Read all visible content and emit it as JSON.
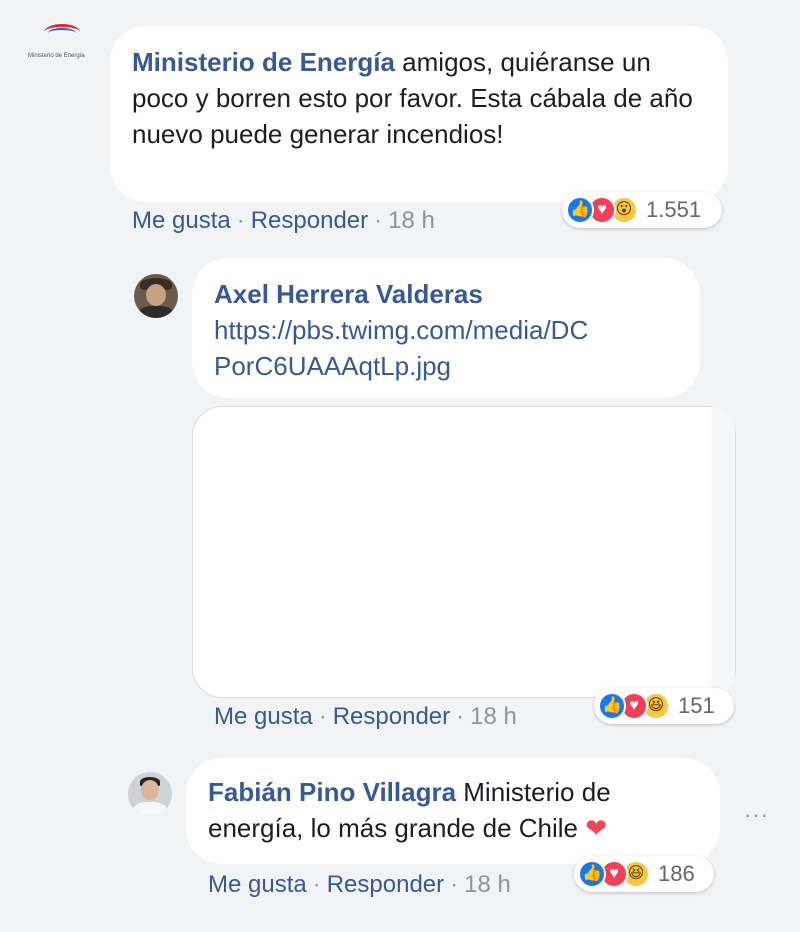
{
  "comments": [
    {
      "author": "Ministerio de Energía",
      "text": " amigos, quiéranse un poco y borren esto por favor. Esta cábala de año nuevo puede generar incendios!",
      "avatar_text": "Ministerio de Energía",
      "actions": {
        "like": "Me gusta",
        "reply": "Responder",
        "time": "18 h"
      },
      "reactions": {
        "icons": [
          "like",
          "love",
          "wow"
        ],
        "count": "1.551"
      }
    },
    {
      "author": "Axel Herrera Valderas",
      "link": "https://pbs.twimg.com/media/DC PorC6UAAAqtLp.jpg",
      "link_line1": "https://pbs.twimg.com/media/DC",
      "link_line2": "PorC6UAAAqtLp.jpg",
      "actions": {
        "like": "Me gusta",
        "reply": "Responder",
        "time": "18 h"
      },
      "reactions": {
        "icons": [
          "like",
          "love",
          "haha"
        ],
        "count": "151"
      }
    },
    {
      "author": "Fabián Pino Villagra",
      "text": " Ministerio de energía, lo más grande de Chile",
      "emoji": "heart",
      "actions": {
        "like": "Me gusta",
        "reply": "Responder",
        "time": "18 h"
      },
      "reactions": {
        "icons": [
          "like",
          "love",
          "haha"
        ],
        "count": "186"
      }
    }
  ],
  "separator": "·",
  "more_label": "···",
  "colors": {
    "link": "#385898",
    "bubble": "#ffffff",
    "background": "#f2f3f5",
    "like": "#1877f2",
    "love": "#f33e58",
    "wow": "#f7c742"
  }
}
